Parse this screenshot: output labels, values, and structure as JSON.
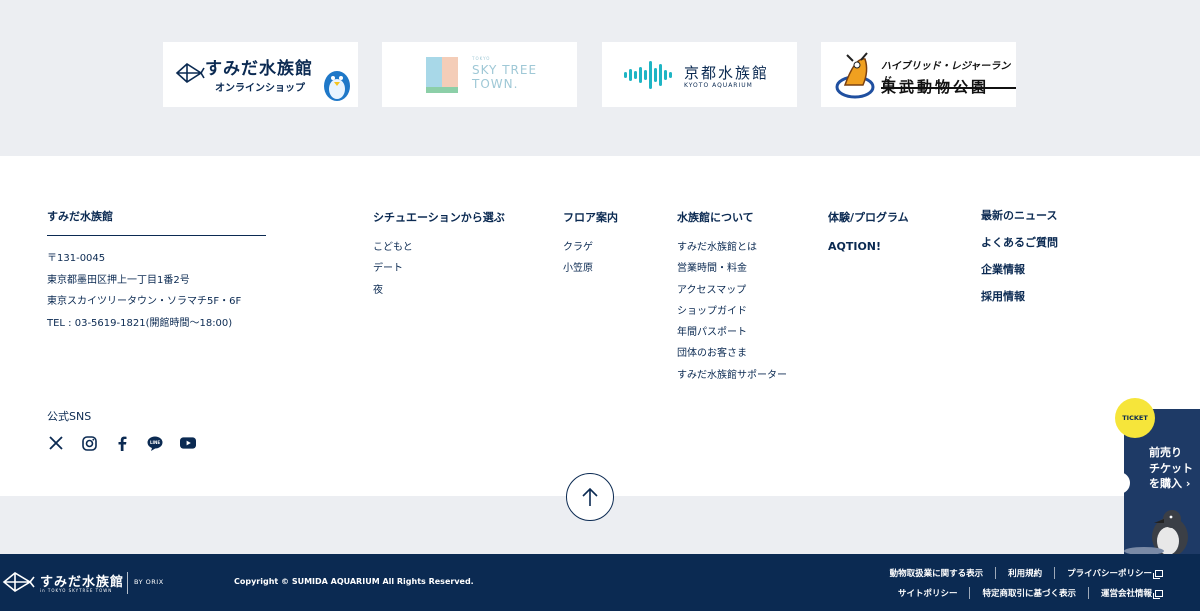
{
  "partners": {
    "sumida_shop": {
      "title": "すみだ水族館",
      "subtitle": "オンラインショップ"
    },
    "skytree": {
      "small": "TOKYO",
      "line1": "SKY TREE",
      "line2": "TOWN."
    },
    "kyoto": {
      "title": "京都水族館",
      "subtitle": "KYOTO AQUARIUM"
    },
    "tobu": {
      "top": "ハイブリッド・レジャーランド",
      "bottom": "東武動物公園"
    }
  },
  "footer": {
    "brand": "すみだ水族館",
    "address": [
      "〒131-0045",
      "東京都墨田区押上一丁目1番2号",
      "東京スカイツリータウン・ソラマチ5F・6F",
      "TEL : 03-5619-1821(開館時間〜18:00)"
    ],
    "sns_title": "公式SNS",
    "columns": {
      "situation": {
        "title": "シチュエーションから選ぶ",
        "items": [
          "こどもと",
          "デート",
          "夜"
        ]
      },
      "floor": {
        "title": "フロア案内",
        "items": [
          "クラゲ",
          "小笠原"
        ]
      },
      "about": {
        "title": "水族館について",
        "items": [
          "すみだ水族館とは",
          "営業時間・料金",
          "アクセスマップ",
          "ショップガイド",
          "年間パスポート",
          "団体のお客さま",
          "すみだ水族館サポーター"
        ]
      },
      "program": {
        "title": "体験/プログラム",
        "items": [
          "AQTION!"
        ]
      },
      "misc": {
        "items": [
          "最新のニュース",
          "よくあるご質問",
          "企業情報",
          "採用情報"
        ]
      }
    }
  },
  "bottom": {
    "name": "すみだ水族館",
    "name_sub": "in TOKYO SKYTREE TOWN",
    "by": "BY ORIX",
    "copyright": "Copyright © SUMIDA AQUARIUM All Rights Reserved.",
    "links_row1": [
      "動物取扱業に関する表示",
      "利用規約",
      "プライバシーポリシー"
    ],
    "links_row2": [
      "サイトポリシー",
      "特定商取引に基づく表示",
      "運営会社情報"
    ]
  },
  "ticket": {
    "badge": "TICKET",
    "line1": "前売り",
    "line2": "チケット",
    "line3": "を購入 ›"
  },
  "colors": {
    "navy": "#0b2a52",
    "grey": "#eceef2",
    "ticket_badge": "#f6e53a",
    "kyoto_teal": "#1fb5c4"
  }
}
